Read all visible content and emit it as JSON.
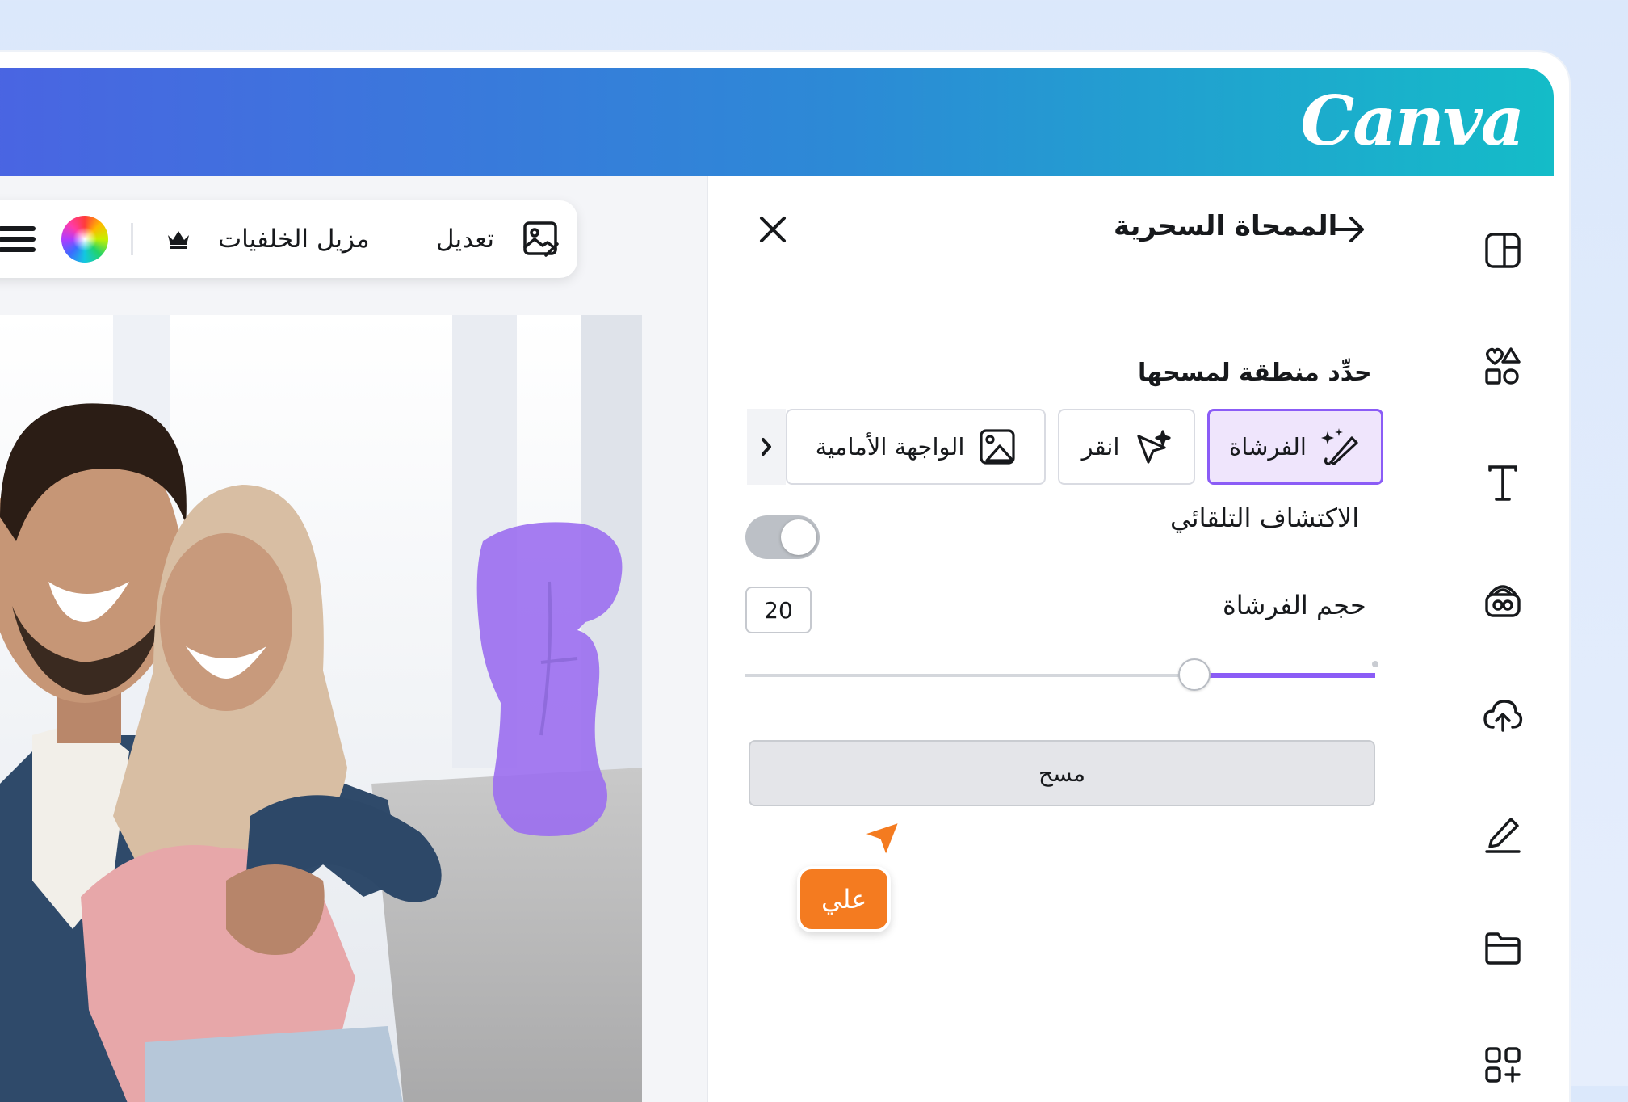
{
  "brand": {
    "logo_text": "Canva"
  },
  "toolbar": {
    "edit_label": "تعديل",
    "bg_remover_label": "مزيل الخلفيات"
  },
  "panel": {
    "title": "الممحاة السحرية",
    "section_label": "حدِّد منطقة لمسحها",
    "modes": [
      {
        "label": "الفرشاة",
        "icon": "magic-brush-icon",
        "active": true
      },
      {
        "label": "انقر",
        "icon": "magic-click-icon",
        "active": false
      },
      {
        "label": "الواجهة الأمامية",
        "icon": "foreground-image-icon",
        "active": false
      }
    ],
    "auto_detect_label": "الاكتشاف التلقائي",
    "auto_detect_on": false,
    "brush_size_label": "حجم الفرشاة",
    "brush_size_value": "20",
    "erase_button_label": "مسح"
  },
  "cursor": {
    "name_tag": "علي",
    "color": "#f47b20"
  },
  "colors": {
    "accent": "#8b5cf6",
    "brush_overlay": "#9b6ef0"
  }
}
